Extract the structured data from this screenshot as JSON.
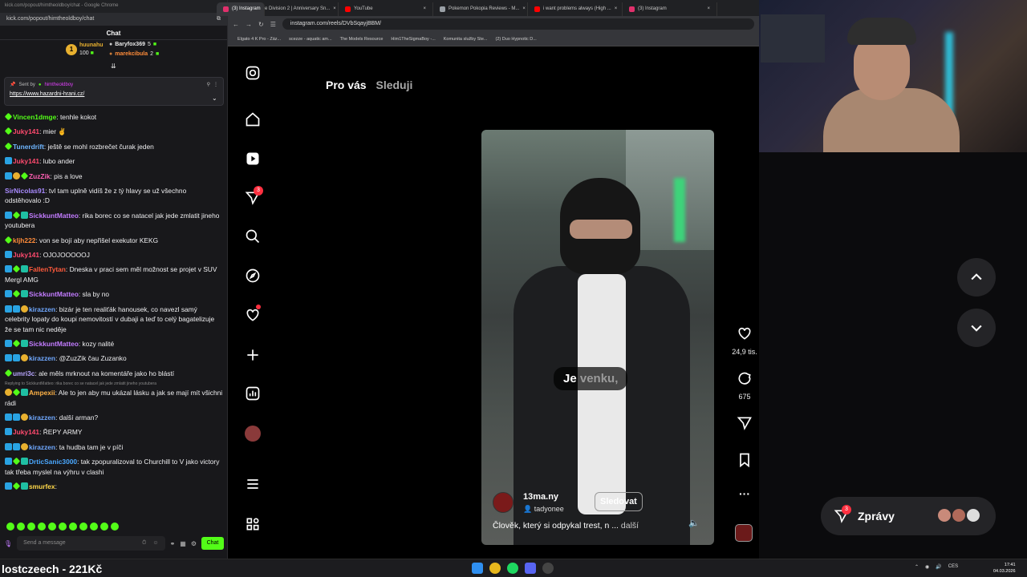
{
  "chat_window": {
    "titlebar": "kick.com/popout/himtheoldboy/chat - Google Chrome",
    "url": "kick.com/popout/himtheoldboy/chat",
    "header": "Chat",
    "gifters": [
      {
        "name": "huunahu",
        "count": "100"
      },
      {
        "name": "Baryfox369",
        "count": "5"
      },
      {
        "name": "marekcibula",
        "count": "2"
      }
    ],
    "pinned": {
      "sent_by": "Sent by",
      "author": "himtheoldboy",
      "link": "https://www.hazardni-hrani.cz/"
    },
    "messages": [
      {
        "user": "Vincen1dmge",
        "color": "#53fc18",
        "text": ": tenhle kokot"
      },
      {
        "user": "Juky141",
        "color": "#ff4a6e",
        "text": ": mier ✌"
      },
      {
        "user": "Tunerdrift",
        "color": "#6fb6ff",
        "text": ": ještě se mohl rozbrečet čurak jeden"
      },
      {
        "user": "Juky141",
        "color": "#ff4a6e",
        "text": ": lubo ander"
      },
      {
        "user": "ZuzZik",
        "color": "#ff5fb3",
        "text": ": pis a love"
      },
      {
        "user": "SirNicolas91",
        "color": "#a98bff",
        "text": ": tvl tam uplně vidíš že z tý hlavy se už všechno odstěhovalo :D"
      },
      {
        "user": "SickkuntMatteo",
        "color": "#c27cff",
        "text": ": rika borec co se natacel jak jede zmlatit jineho youtubera"
      },
      {
        "user": "kljh222",
        "color": "#ff8c3a",
        "text": ": von se bojí aby nepřišel exekutor KEKG"
      },
      {
        "user": "Juky141",
        "color": "#ff4a6e",
        "text": ": OJOJOOOOOJ"
      },
      {
        "user": "FallenTytan",
        "color": "#ff5a3c",
        "text": ": Dneska v praci sem měl možnost se projet v SUV Mergl AMG"
      },
      {
        "user": "SickkuntMatteo",
        "color": "#c27cff",
        "text": ": sla by no"
      },
      {
        "user": "kirazzen",
        "color": "#6fa8ff",
        "text": ": bizár je ten realiťák hanousek, co navezl samý celebrity lopaty do koupi nemovitostí v dubaji a teď to celý bagatelizuje že se tam nic neděje"
      },
      {
        "user": "SickkuntMatteo",
        "color": "#c27cff",
        "text": ": kozy nalité"
      },
      {
        "user": "kirazzen",
        "color": "#6fa8ff",
        "text": ": @ZuzZik čau Zuzanko"
      },
      {
        "user": "umri3c",
        "color": "#b8a6ff",
        "text": ": ale měls mrknout na komentáře jako ho blástí"
      },
      {
        "user": "Ampexii",
        "color": "#ffb347",
        "text": ": Ale to jen aby mu ukázal lásku a jak se mají mít všichni rádi",
        "reply": "Replying to SickkuntMatteo: rika borec co se natacel jak jede zmlatit jineho youtubera"
      },
      {
        "user": "kirazzen",
        "color": "#6fa8ff",
        "text": ": další arman?"
      },
      {
        "user": "Juky141",
        "color": "#ff4a6e",
        "text": ": ŘEPY ARMY"
      },
      {
        "user": "kirazzen",
        "color": "#6fa8ff",
        "text": ": ta hudba tam je v píči"
      },
      {
        "user": "DrticSanic3000",
        "color": "#4aa8ff",
        "text": ": tak zpopuralizoval to Churchill to V jako victory tak třeba myslel na výhru v clashi"
      },
      {
        "user": "smurfex",
        "color": "#ffd84a",
        "text": ":"
      }
    ],
    "input_placeholder": "Send a message",
    "chat_button": "Chat"
  },
  "browser": {
    "tabs": [
      {
        "label": "(3) Instagram",
        "color": "#e1306c"
      },
      {
        "label": "The Division 2 | Anniversary Sn...",
        "color": "#ff0000"
      },
      {
        "label": "YouTube",
        "color": "#ff0000"
      },
      {
        "label": "Pokemon Pokopia Reviews - M...",
        "color": "#9aa0a6"
      },
      {
        "label": "i want problems always (High ...",
        "color": "#ff0000"
      },
      {
        "label": "(3) Instagram",
        "color": "#e1306c"
      }
    ],
    "url": "instagram.com/reels/DVbSqayjBBM/",
    "bookmarks": [
      "Elgato 4 K Pro - Záz...",
      "scezze - aquatic am...",
      "The Models Resource",
      "Him1TheSigmaBoy -...",
      "Komunita služby Ste...",
      "(2) Duo Hypnotic D..."
    ]
  },
  "instagram": {
    "nav_badge": "3",
    "feed_tabs": {
      "active": "Pro vás",
      "inactive": "Sleduji"
    },
    "reel": {
      "caption_word": "Je",
      "caption_dim": "venku,",
      "username": "13ma.ny",
      "audio": "tadyonee",
      "follow_label": "Sledovat",
      "description": "Člověk, který si odpykal trest, n ...",
      "more_label": "další"
    },
    "likes": "24,9 tis.",
    "comments": "675",
    "messages_label": "Zprávy",
    "messages_badge": "3"
  },
  "taskbar": {
    "ticker": "lostczeech - 221Kč",
    "lang": "CES",
    "time": "17:41",
    "date": "04.03.2026"
  }
}
